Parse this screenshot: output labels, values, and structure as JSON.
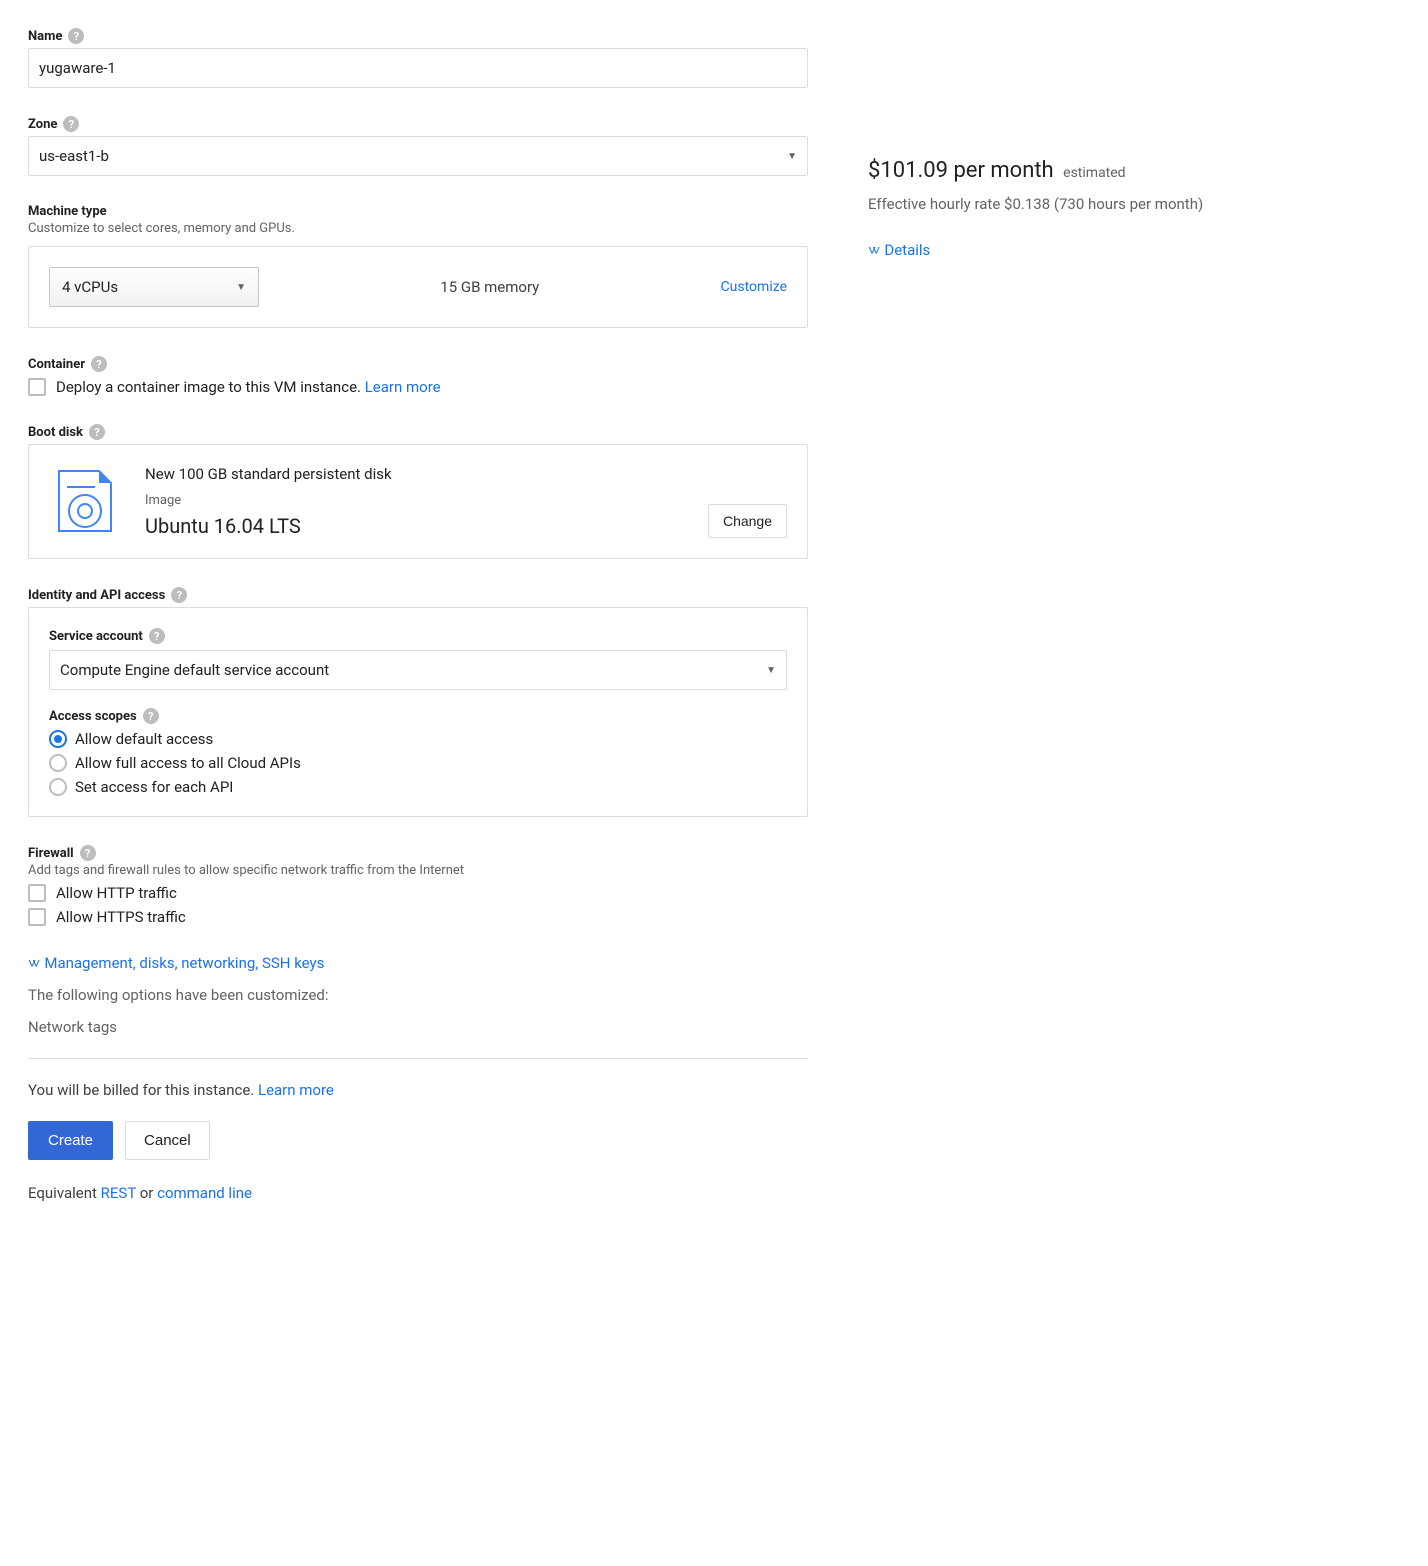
{
  "name": {
    "label": "Name",
    "value": "yugaware-1"
  },
  "zone": {
    "label": "Zone",
    "value": "us-east1-b"
  },
  "machine": {
    "label": "Machine type",
    "sub": "Customize to select cores, memory and GPUs.",
    "vcpu": "4 vCPUs",
    "memory": "15 GB memory",
    "customize": "Customize"
  },
  "container": {
    "label": "Container",
    "text": "Deploy a container image to this VM instance.",
    "learn": "Learn more"
  },
  "bootdisk": {
    "label": "Boot disk",
    "title": "New 100 GB standard persistent disk",
    "image_label": "Image",
    "os": "Ubuntu 16.04 LTS",
    "change": "Change"
  },
  "identity": {
    "label": "Identity and API access",
    "service_account_label": "Service account",
    "service_account_value": "Compute Engine default service account",
    "scopes_label": "Access scopes",
    "scopes": [
      "Allow default access",
      "Allow full access to all Cloud APIs",
      "Set access for each API"
    ]
  },
  "firewall": {
    "label": "Firewall",
    "sub": "Add tags and firewall rules to allow specific network traffic from the Internet",
    "http": "Allow HTTP traffic",
    "https": "Allow HTTPS traffic"
  },
  "expand": {
    "label": "Management, disks, networking, SSH keys"
  },
  "customized": {
    "heading": "The following options have been customized:",
    "item": "Network tags"
  },
  "billing": {
    "text": "You will be billed for this instance.",
    "learn": "Learn more"
  },
  "buttons": {
    "create": "Create",
    "cancel": "Cancel"
  },
  "equiv": {
    "prefix": "Equivalent ",
    "rest": "REST",
    "or": " or ",
    "cmd": "command line"
  },
  "pricing": {
    "headline": "$101.09 per month",
    "estimated": "estimated",
    "sub": "Effective hourly rate $0.138 (730 hours per month)",
    "details": "Details"
  }
}
